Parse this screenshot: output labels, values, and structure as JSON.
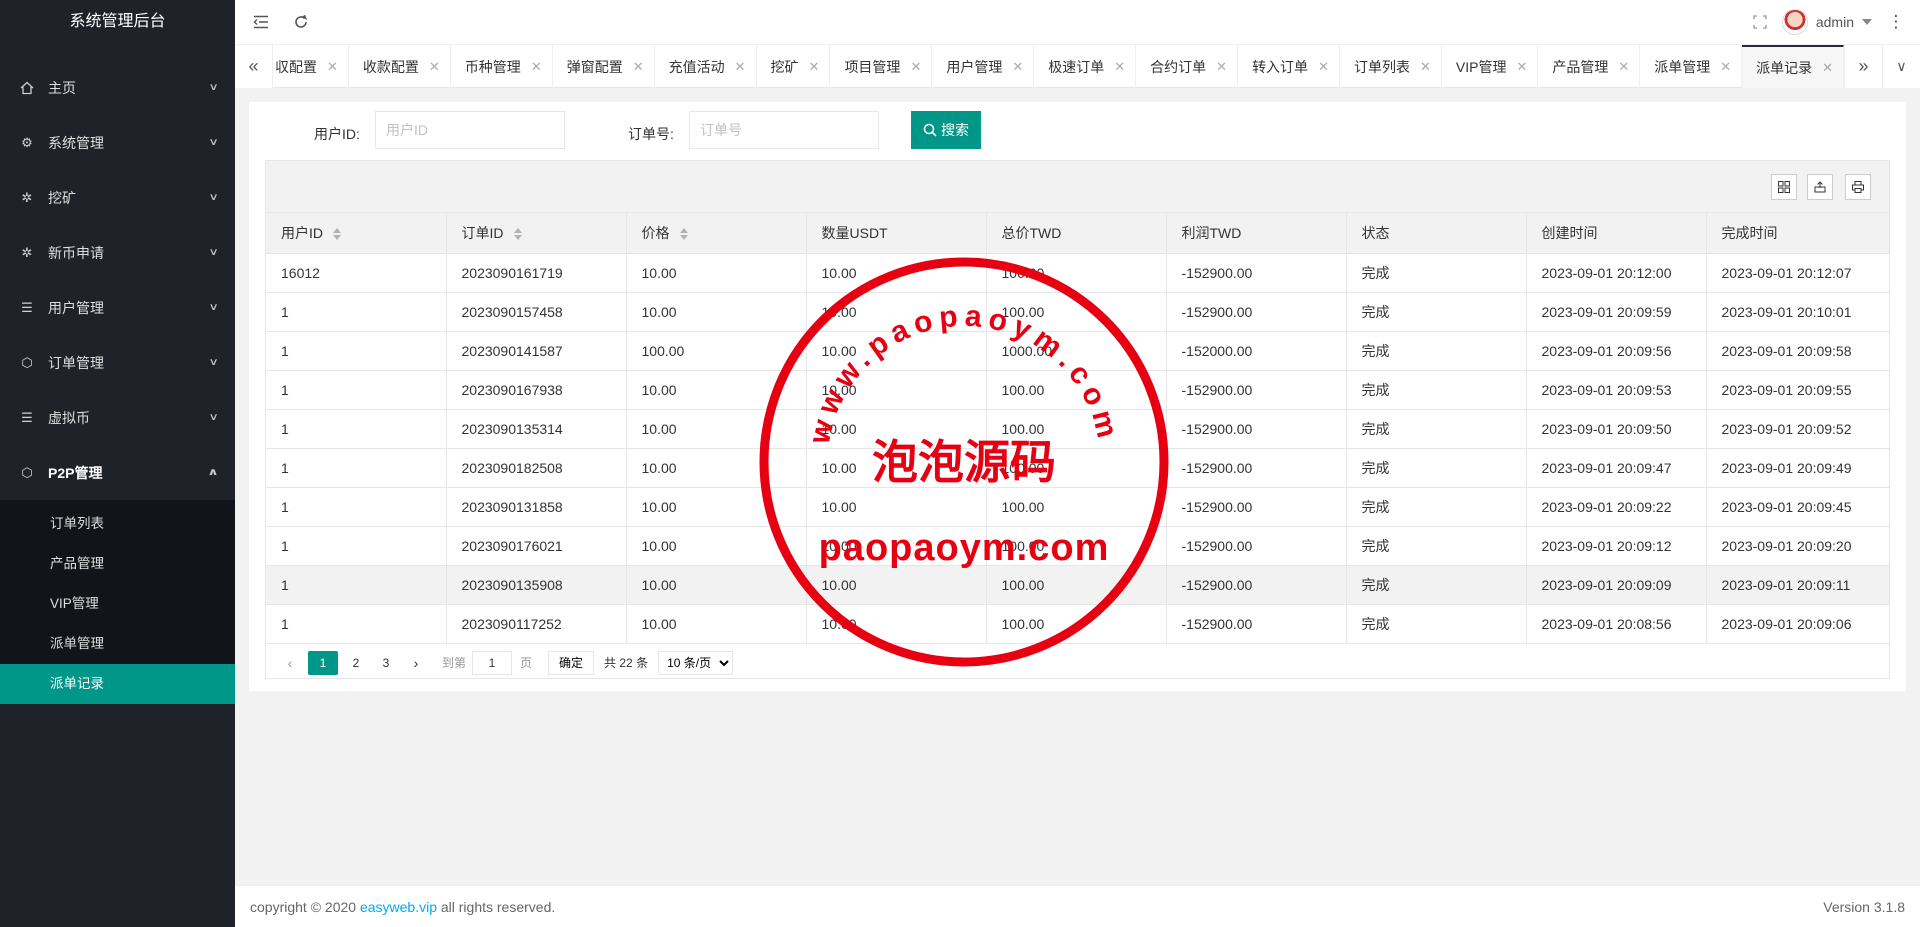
{
  "brand": "系统管理后台",
  "sidebar": {
    "menu": [
      {
        "label": "主页",
        "icon": "home-icon"
      },
      {
        "label": "系统管理",
        "icon": "gear-icon"
      },
      {
        "label": "挖矿",
        "icon": "settings-icon"
      },
      {
        "label": "新币申请",
        "icon": "settings-icon"
      },
      {
        "label": "用户管理",
        "icon": "list-icon"
      },
      {
        "label": "订单管理",
        "icon": "cube-icon"
      },
      {
        "label": "虚拟币",
        "icon": "list-icon"
      },
      {
        "label": "P2P管理",
        "icon": "cube-icon"
      }
    ],
    "submenu": [
      "订单列表",
      "产品管理",
      "VIP管理",
      "派单管理",
      "派单记录"
    ]
  },
  "header": {
    "user": "admin"
  },
  "tabs": [
    "収配置",
    "收款配置",
    "币种管理",
    "弹窗配置",
    "充值活动",
    "挖矿",
    "项目管理",
    "用户管理",
    "极速订单",
    "合约订单",
    "转入订单",
    "订单列表",
    "VIP管理",
    "产品管理",
    "派单管理",
    "派单记录"
  ],
  "search": {
    "user_label": "用户ID:",
    "user_placeholder": "用户ID",
    "order_label": "订单号:",
    "order_placeholder": "订单号",
    "button": "搜索"
  },
  "table": {
    "columns": [
      "用户ID",
      "订单ID",
      "价格",
      "数量USDT",
      "总价TWD",
      "利润TWD",
      "状态",
      "创建时间",
      "完成时间"
    ],
    "rows": [
      [
        "16012",
        "2023090161719",
        "10.00",
        "10.00",
        "100.00",
        "-152900.00",
        "完成",
        "2023-09-01 20:12:00",
        "2023-09-01 20:12:07"
      ],
      [
        "1",
        "2023090157458",
        "10.00",
        "10.00",
        "100.00",
        "-152900.00",
        "完成",
        "2023-09-01 20:09:59",
        "2023-09-01 20:10:01"
      ],
      [
        "1",
        "2023090141587",
        "100.00",
        "10.00",
        "1000.00",
        "-152000.00",
        "完成",
        "2023-09-01 20:09:56",
        "2023-09-01 20:09:58"
      ],
      [
        "1",
        "2023090167938",
        "10.00",
        "10.00",
        "100.00",
        "-152900.00",
        "完成",
        "2023-09-01 20:09:53",
        "2023-09-01 20:09:55"
      ],
      [
        "1",
        "2023090135314",
        "10.00",
        "10.00",
        "100.00",
        "-152900.00",
        "完成",
        "2023-09-01 20:09:50",
        "2023-09-01 20:09:52"
      ],
      [
        "1",
        "2023090182508",
        "10.00",
        "10.00",
        "100.00",
        "-152900.00",
        "完成",
        "2023-09-01 20:09:47",
        "2023-09-01 20:09:49"
      ],
      [
        "1",
        "2023090131858",
        "10.00",
        "10.00",
        "100.00",
        "-152900.00",
        "完成",
        "2023-09-01 20:09:22",
        "2023-09-01 20:09:45"
      ],
      [
        "1",
        "2023090176021",
        "10.00",
        "10.00",
        "100.00",
        "-152900.00",
        "完成",
        "2023-09-01 20:09:12",
        "2023-09-01 20:09:20"
      ],
      [
        "1",
        "2023090135908",
        "10.00",
        "10.00",
        "100.00",
        "-152900.00",
        "完成",
        "2023-09-01 20:09:09",
        "2023-09-01 20:09:11"
      ],
      [
        "1",
        "2023090117252",
        "10.00",
        "10.00",
        "100.00",
        "-152900.00",
        "完成",
        "2023-09-01 20:08:56",
        "2023-09-01 20:09:06"
      ]
    ]
  },
  "pager": {
    "pages": [
      "1",
      "2",
      "3"
    ],
    "goto_label": "到第",
    "goto_value": "1",
    "page_unit": "页",
    "confirm": "确定",
    "total": "共 22 条",
    "page_size": "10 条/页"
  },
  "footer": {
    "prefix": "copyright © 2020 ",
    "link": "easyweb.vip",
    "suffix": " all rights reserved.",
    "version": "Version 3.1.8"
  },
  "watermark": {
    "arc_text": "www.paopaoym.com",
    "center_text": "泡泡源码",
    "bottom_text": "paopaoym.com"
  },
  "colors": {
    "sidebar_bg": "#20222a",
    "accent": "#009688",
    "stamp": "#e60012"
  }
}
